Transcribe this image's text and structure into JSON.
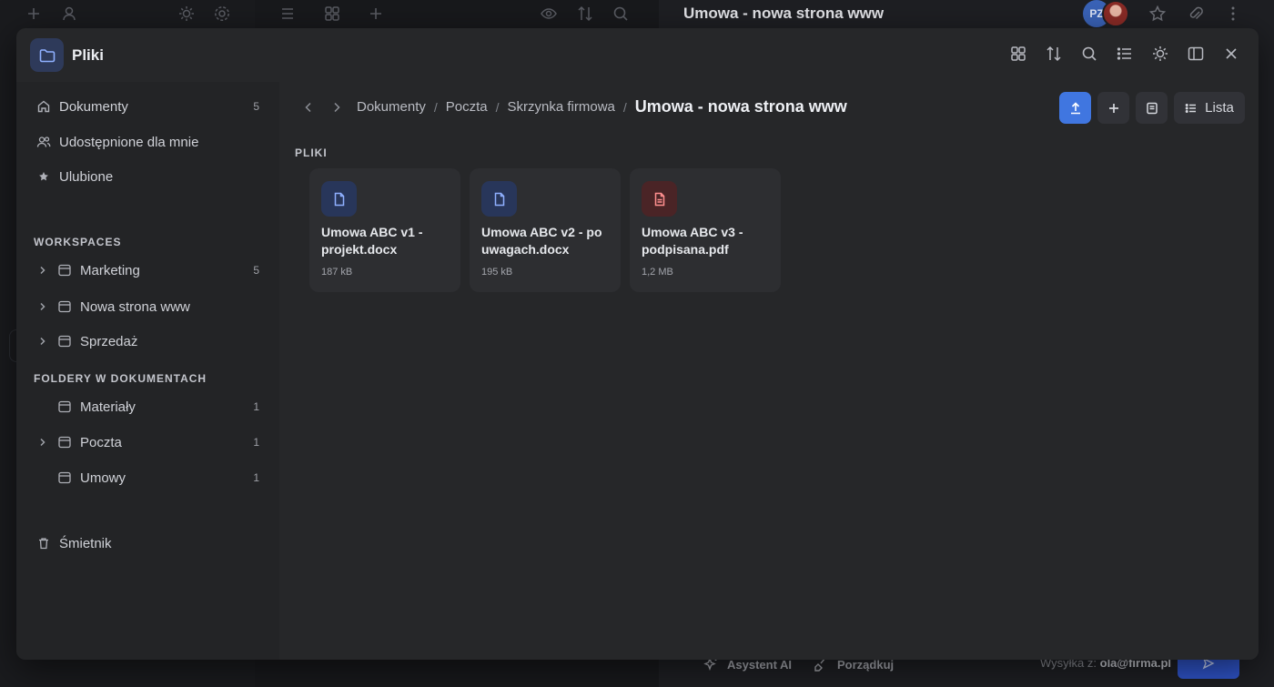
{
  "background": {
    "title": "Umowa - nowa strona www",
    "avatar_initials": "PZ",
    "ai_button": "Asystent AI",
    "tidy_button": "Porządkuj",
    "sender_label": "Wysyłka z:",
    "sender_email": "ola@firma.pl"
  },
  "modal": {
    "title": "Pliki"
  },
  "sidebar": {
    "main_items": [
      {
        "label": "Dokumenty",
        "count": "5",
        "icon": "home-icon"
      },
      {
        "label": "Udostępnione dla mnie",
        "icon": "users-icon"
      },
      {
        "label": "Ulubione",
        "icon": "star-icon"
      }
    ],
    "workspaces_heading": "WORKSPACES",
    "workspaces": [
      {
        "label": "Marketing",
        "count": "5"
      },
      {
        "label": "Nowa strona www"
      },
      {
        "label": "Sprzedaż"
      }
    ],
    "doc_folders_heading": "FOLDERY W DOKUMENTACH",
    "doc_folders": [
      {
        "label": "Materiały",
        "count": "1"
      },
      {
        "label": "Poczta",
        "count": "1"
      },
      {
        "label": "Umowy",
        "count": "1"
      }
    ],
    "trash": {
      "label": "Śmietnik",
      "icon": "trash-icon"
    }
  },
  "breadcrumb": {
    "items": [
      "Dokumenty",
      "Poczta",
      "Skrzynka firmowa"
    ],
    "current": "Umowa - nowa strona www"
  },
  "actions": {
    "view_label": "Lista"
  },
  "files": {
    "heading": "PLIKI",
    "items": [
      {
        "name": "Umowa ABC v1 - projekt.docx",
        "size": "187 kB",
        "type": "doc"
      },
      {
        "name": "Umowa ABC v2 - po uwagach.docx",
        "size": "195 kB",
        "type": "doc"
      },
      {
        "name": "Umowa ABC v3 - podpisana.pdf",
        "size": "1,2 MB",
        "type": "pdf"
      }
    ]
  },
  "colors": {
    "accent": "#4076e0",
    "modal_bg": "#262729",
    "sidebar_bg": "#232426",
    "pdf_accent": "#ff8f8f"
  }
}
